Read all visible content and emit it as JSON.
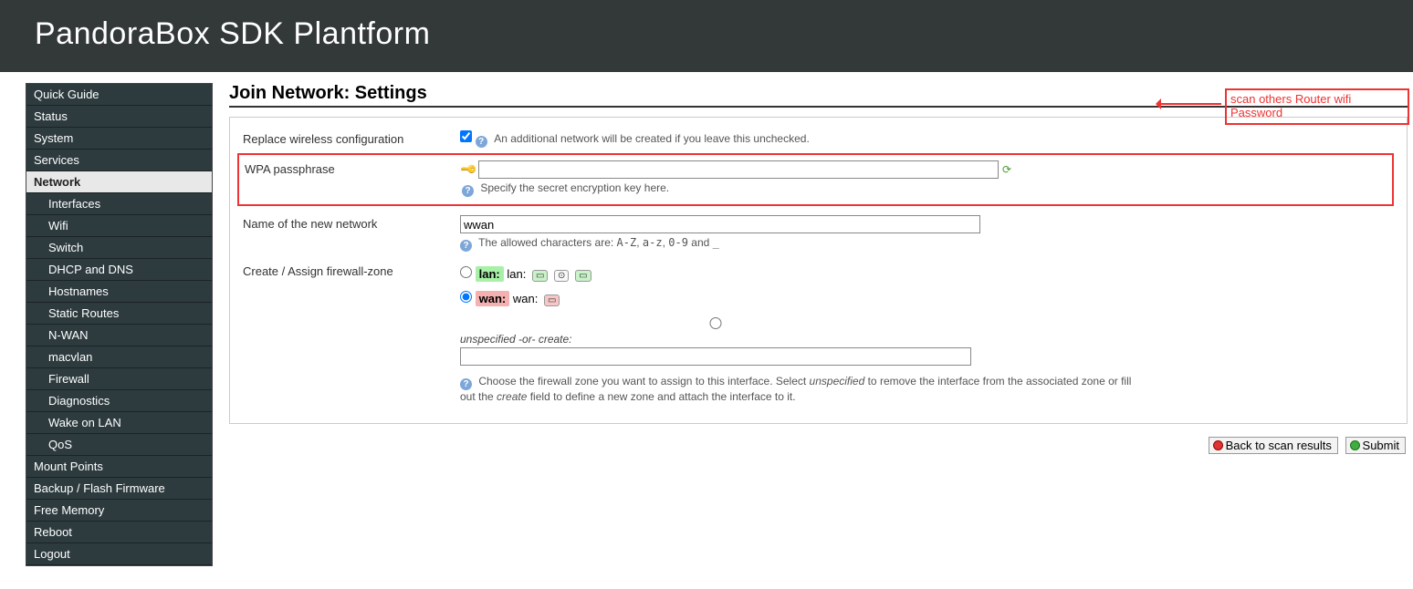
{
  "header": {
    "title": "PandoraBox SDK Plantform"
  },
  "sidebar": {
    "items": [
      {
        "label": "Quick Guide"
      },
      {
        "label": "Status"
      },
      {
        "label": "System"
      },
      {
        "label": "Services"
      },
      {
        "label": "Network",
        "active": true
      },
      {
        "label": "Interfaces",
        "sub": true
      },
      {
        "label": "Wifi",
        "sub": true
      },
      {
        "label": "Switch",
        "sub": true
      },
      {
        "label": "DHCP and DNS",
        "sub": true
      },
      {
        "label": "Hostnames",
        "sub": true
      },
      {
        "label": "Static Routes",
        "sub": true
      },
      {
        "label": "N-WAN",
        "sub": true
      },
      {
        "label": "macvlan",
        "sub": true
      },
      {
        "label": "Firewall",
        "sub": true
      },
      {
        "label": "Diagnostics",
        "sub": true
      },
      {
        "label": "Wake on LAN",
        "sub": true
      },
      {
        "label": "QoS",
        "sub": true
      },
      {
        "label": "Mount Points"
      },
      {
        "label": "Backup / Flash Firmware"
      },
      {
        "label": "Free Memory"
      },
      {
        "label": "Reboot"
      },
      {
        "label": "Logout"
      }
    ]
  },
  "page": {
    "title": "Join Network: Settings",
    "annotation": "scan others Router wifi Password"
  },
  "form": {
    "replace": {
      "label": "Replace wireless configuration",
      "checked": true,
      "hint": "An additional network will be created if you leave this unchecked."
    },
    "wpa": {
      "label": "WPA passphrase",
      "value": "",
      "hint": "Specify the secret encryption key here."
    },
    "netname": {
      "label": "Name of the new network",
      "value": "wwan",
      "hint_prefix": "The allowed characters are: ",
      "hint_code1": "A-Z",
      "hint_sep1": ", ",
      "hint_code2": "a-z",
      "hint_sep2": ", ",
      "hint_code3": "0-9",
      "hint_sep3": " and ",
      "hint_code4": "_"
    },
    "zone": {
      "label": "Create / Assign firewall-zone",
      "options": {
        "lan": {
          "name": "lan:",
          "iface": "lan:",
          "selected": false
        },
        "wan": {
          "name": "wan:",
          "iface": "wan:",
          "selected": true
        },
        "unspec_label": "unspecified -or- create:",
        "unspec_value": ""
      },
      "hint_a": "Choose the firewall zone you want to assign to this interface. Select ",
      "hint_em1": "unspecified",
      "hint_b": " to remove the interface from the associated zone or fill out the ",
      "hint_em2": "create",
      "hint_c": " field to define a new zone and attach the interface to it."
    }
  },
  "actions": {
    "back": "Back to scan results",
    "submit": "Submit"
  }
}
